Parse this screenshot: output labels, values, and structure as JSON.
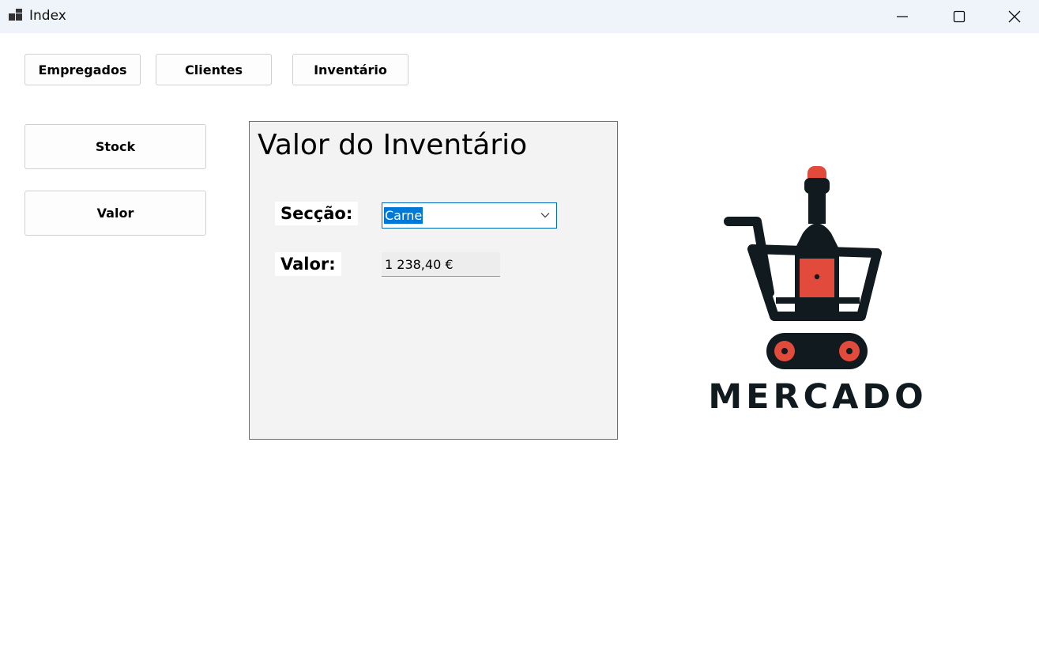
{
  "window": {
    "title": "Index",
    "icon": "app-window-icon",
    "controls": [
      "minimize-icon",
      "maximize-icon",
      "close-icon"
    ]
  },
  "nav": {
    "empregados": "Empregados",
    "clientes": "Clientes",
    "inventario": "Inventário"
  },
  "side": {
    "stock": "Stock",
    "valor": "Valor"
  },
  "panel": {
    "title": "Valor do Inventário",
    "seccao_label": "Secção:",
    "seccao_value": "Carne",
    "valor_label": "Valor:",
    "valor_value": "1 238,40 €"
  },
  "logo": {
    "text": "MERCADO",
    "colors": {
      "dark": "#111a1e",
      "accent": "#e24a3b"
    }
  },
  "colors": {
    "titlebar": "#eff3fa",
    "panel_bg": "#f3f3f3",
    "selection": "#0078d7",
    "combo_border": "#0067c0"
  }
}
